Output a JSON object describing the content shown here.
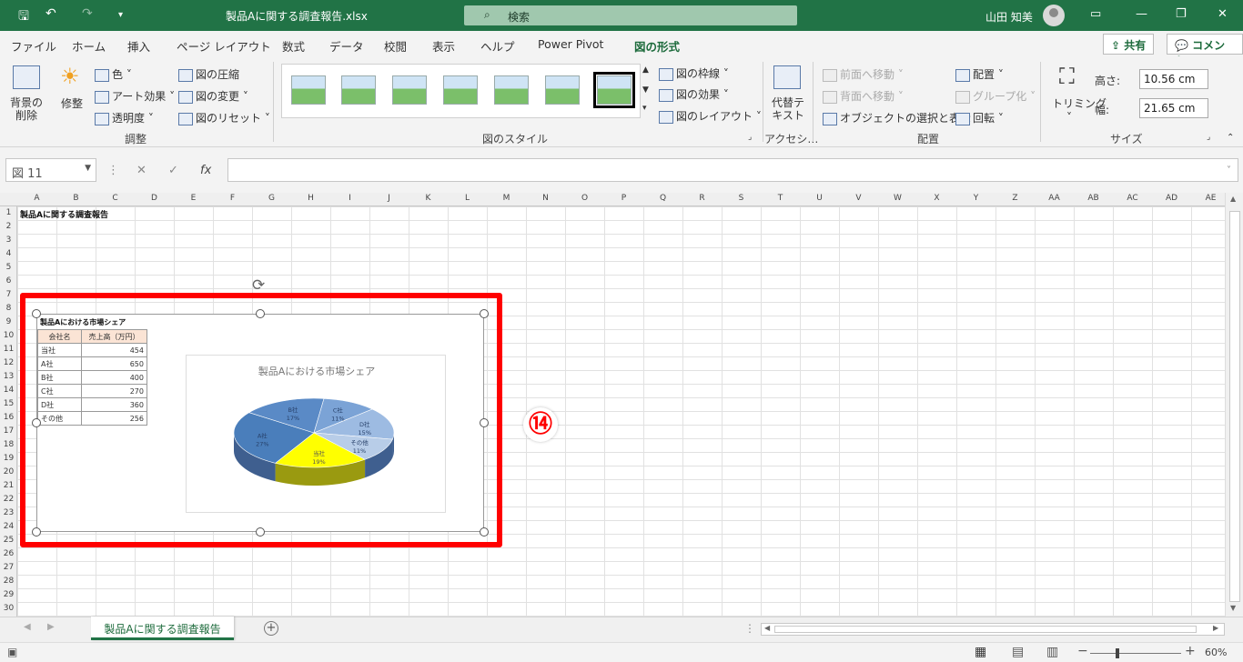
{
  "window": {
    "title": "製品Aに関する調査報告.xlsx",
    "search": "検索",
    "user": "山田 知美"
  },
  "tabs": [
    "ファイル",
    "ホーム",
    "挿入",
    "ページ レイアウト",
    "数式",
    "データ",
    "校閲",
    "表示",
    "ヘルプ",
    "Power Pivot",
    "図の形式"
  ],
  "share": {
    "share_label": "共有",
    "comment_label": "コメント"
  },
  "ribbon": {
    "adjust": {
      "remove_bg": "背景の\n削除",
      "corrections": "修整",
      "color": "色",
      "artistic": "アート効果",
      "transparency": "透明度",
      "compress": "図の圧縮",
      "change": "図の変更",
      "reset": "図のリセット",
      "group_label": "調整"
    },
    "styles": {
      "border": "図の枠線",
      "effects": "図の効果",
      "layout": "図のレイアウト",
      "group_label": "図のスタイル"
    },
    "accessibility": {
      "alt_text": "代替テ\nキスト",
      "group_label": "アクセシ…"
    },
    "arrange": {
      "forward": "前面へ移動",
      "backward": "背面へ移動",
      "selection": "オブジェクトの選択と表示",
      "align": "配置",
      "group": "グループ化",
      "rotate": "回転",
      "group_label": "配置"
    },
    "size": {
      "crop": "トリミング",
      "height_label": "高さ:",
      "height": "10.56 cm",
      "width_label": "幅:",
      "width": "21.65 cm",
      "group_label": "サイズ"
    }
  },
  "formula_bar": {
    "name_box": "図 11",
    "fx": "fx",
    "value": ""
  },
  "columns": [
    "A",
    "B",
    "C",
    "D",
    "E",
    "F",
    "G",
    "H",
    "I",
    "J",
    "K",
    "L",
    "M",
    "N",
    "O",
    "P",
    "Q",
    "R",
    "S",
    "T",
    "U",
    "V",
    "W",
    "X",
    "Y",
    "Z",
    "AA",
    "AB",
    "AC",
    "AD",
    "AE"
  ],
  "rows": [
    "1",
    "2",
    "3",
    "4",
    "5",
    "6",
    "7",
    "8",
    "9",
    "10",
    "11",
    "12",
    "13",
    "14",
    "15",
    "16",
    "17",
    "18",
    "19",
    "20",
    "21",
    "22",
    "23",
    "24",
    "25",
    "26",
    "27",
    "28",
    "29",
    "30"
  ],
  "a1_text": "製品Aに関する調査報告",
  "picture": {
    "table_title": "製品Aにおける市場シェア",
    "headers": [
      "会社名",
      "売上高（万円）"
    ],
    "rows": [
      [
        "当社",
        "454"
      ],
      [
        "A社",
        "650"
      ],
      [
        "B社",
        "400"
      ],
      [
        "C社",
        "270"
      ],
      [
        "D社",
        "360"
      ],
      [
        "その他",
        "256"
      ]
    ]
  },
  "chart_data": {
    "type": "pie",
    "title": "製品Aにおける市場シェア",
    "categories": [
      "当社",
      "A社",
      "B社",
      "C社",
      "D社",
      "その他"
    ],
    "values": [
      19,
      27,
      17,
      11,
      15,
      11
    ],
    "colors": [
      "#ffff00",
      "#4a7ebb",
      "#5a8ac6",
      "#7ba3d6",
      "#9dbbe2",
      "#b8cde8"
    ]
  },
  "annotation": "⑭",
  "sheet": {
    "name": "製品Aに関する調査報告"
  },
  "status": {
    "zoom": "60%"
  }
}
